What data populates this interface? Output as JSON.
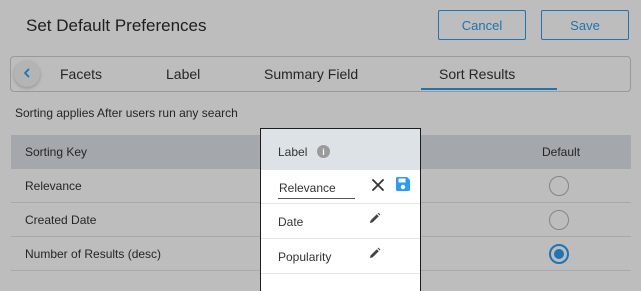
{
  "header": {
    "title": "Set Default Preferences",
    "cancel_label": "Cancel",
    "save_label": "Save"
  },
  "tabs": [
    {
      "label": "Facets"
    },
    {
      "label": "Label"
    },
    {
      "label": "Summary Field"
    },
    {
      "label": "Sort Results",
      "active": true
    }
  ],
  "note": "Sorting applies After users run any search",
  "table": {
    "headers": {
      "key": "Sorting Key",
      "default": "Default"
    },
    "rows": [
      {
        "key": "Relevance",
        "default": false
      },
      {
        "key": "Created Date",
        "default": false
      },
      {
        "key": "Number of Results (desc)",
        "default": true
      }
    ]
  },
  "popup": {
    "header_label": "Label",
    "info_glyph": "i",
    "edit_value": "Relevance",
    "rows": [
      {
        "label": "Date"
      },
      {
        "label": "Popularity"
      }
    ]
  },
  "colors": {
    "accent": "#2d9bf0",
    "header_bg": "#dde2e7",
    "overlay": "rgba(0,0,0,0.26)"
  },
  "icons": {
    "back": "chevron-left-icon",
    "info": "info-icon",
    "cancel_edit": "close-icon",
    "save_edit": "floppy-disk-icon",
    "edit": "pencil-icon"
  }
}
